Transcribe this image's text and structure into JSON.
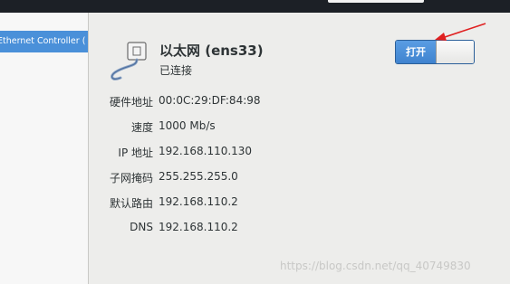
{
  "sidebar": {
    "selected_device": "Ethernet Controller (",
    "selected_bg": "#4a90d9"
  },
  "connection": {
    "title": "以太网 (ens33)",
    "status": "已连接",
    "icon": "ethernet-cable-icon",
    "toggle_label": "打开",
    "toggle_on": true
  },
  "details": [
    {
      "label": "硬件地址",
      "value": "00:0C:29:DF:84:98"
    },
    {
      "label": "速度",
      "value": "1000 Mb/s"
    },
    {
      "label": "IP 地址",
      "value": "192.168.110.130"
    },
    {
      "label": "子网掩码",
      "value": "255.255.255.0"
    },
    {
      "label": "默认路由",
      "value": "192.168.110.2"
    },
    {
      "label": "DNS",
      "value": "192.168.110.2"
    }
  ],
  "watermark": "https://blog.csdn.net/qq_40749830",
  "colors": {
    "accent": "#3f83cf",
    "annotation_arrow": "#e02020",
    "background": "#ededeb"
  }
}
